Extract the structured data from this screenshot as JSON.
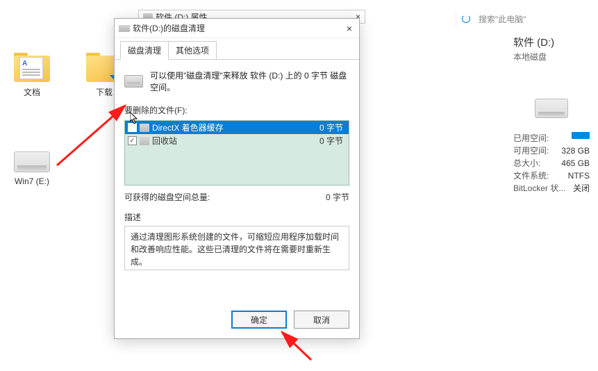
{
  "bg_window": {
    "title": "软件 (D:) 属性",
    "close": "×"
  },
  "search": {
    "placeholder": "搜索\"此电脑\""
  },
  "right_panel": {
    "title": "软件 (D:)",
    "subtitle": "本地磁盘",
    "rows": [
      {
        "label": "已用空间:",
        "value": ""
      },
      {
        "label": "可用空间:",
        "value": "328 GB"
      },
      {
        "label": "总大小:",
        "value": "465 GB"
      },
      {
        "label": "文件系统:",
        "value": "NTFS"
      },
      {
        "label": "BitLocker 状...",
        "value": "关闭"
      }
    ]
  },
  "icons": {
    "docs": "文档",
    "downloads": "下载",
    "drive_e": "Win7 (E:)"
  },
  "dialog": {
    "title": "软件(D:)的磁盘清理",
    "close": "×",
    "tabs": {
      "active": "磁盘清理",
      "other": "其他选项"
    },
    "intro": "可以使用\"磁盘清理\"来释放 软件 (D:) 上的 0 字节 磁盘空间。",
    "files_label": "要删除的文件(F):",
    "files": [
      {
        "name": "DirectX 着色器缓存",
        "size": "0 字节",
        "checked": false,
        "selected": true
      },
      {
        "name": "回收站",
        "size": "0 字节",
        "checked": true,
        "selected": false
      }
    ],
    "total_label": "可获得的磁盘空间总量:",
    "total_value": "0 字节",
    "desc_label": "描述",
    "desc_text": "通过清理图形系统创建的文件，可缩短应用程序加载时间和改善响应性能。这些已清理的文件将在需要时重新生成。",
    "ok": "确定",
    "cancel": "取消"
  }
}
